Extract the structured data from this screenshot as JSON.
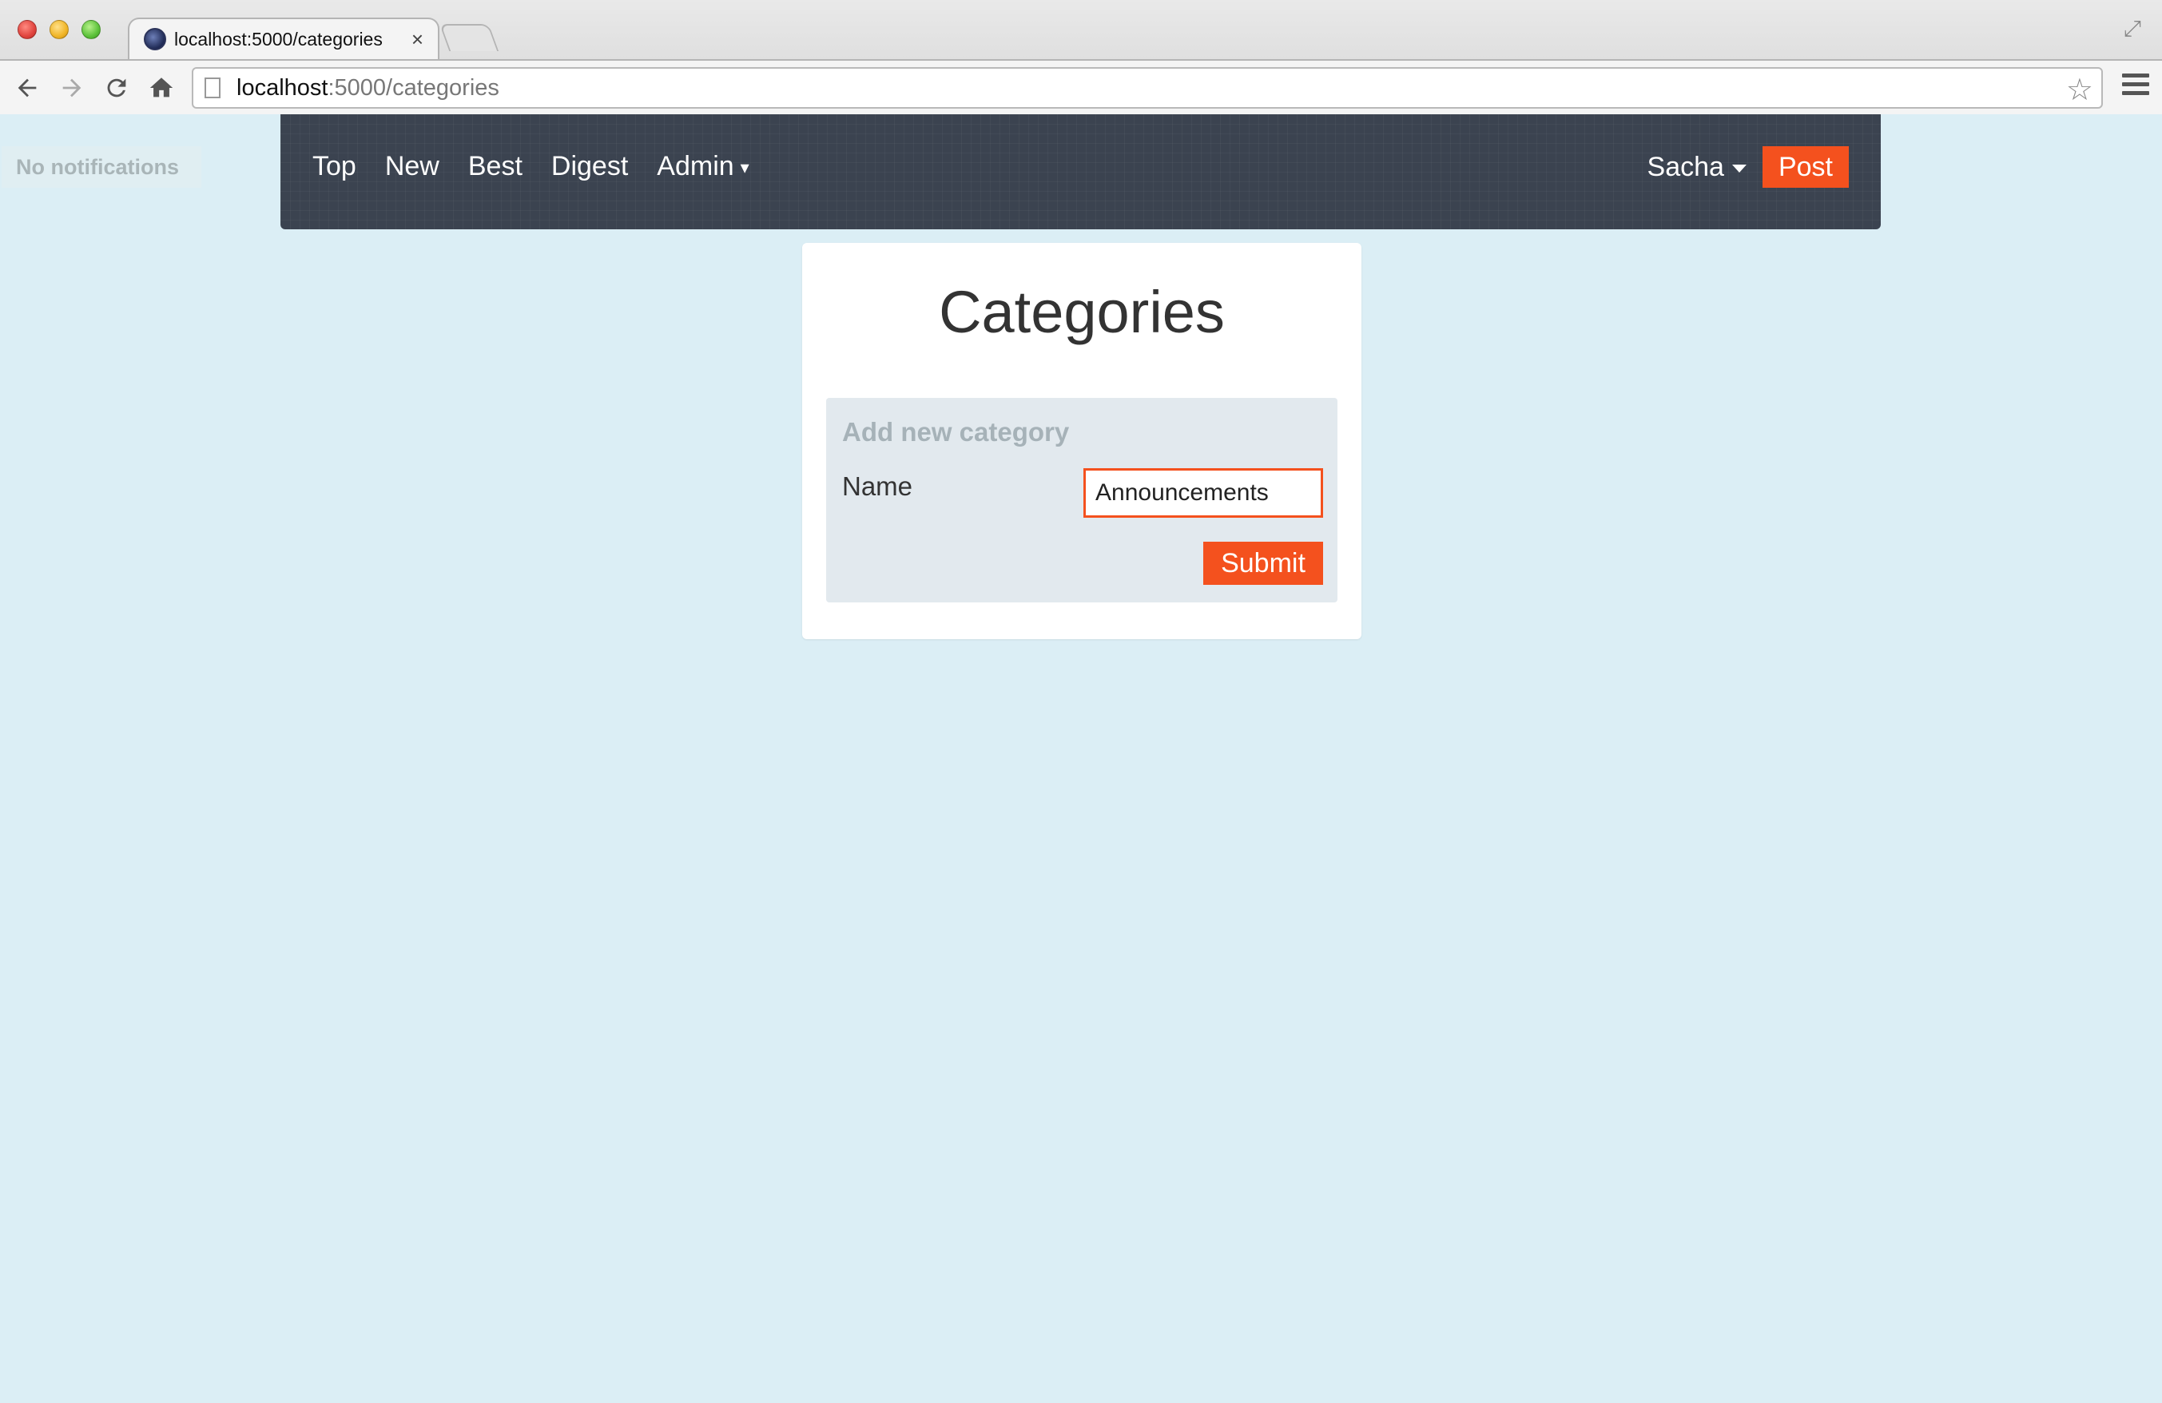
{
  "browser": {
    "tab_title": "localhost:5000/categories",
    "tab_close": "×",
    "url_host": "localhost",
    "url_rest": ":5000/categories"
  },
  "notifications": {
    "label": "No notifications"
  },
  "navbar": {
    "links": [
      {
        "label": "Top"
      },
      {
        "label": "New"
      },
      {
        "label": "Best"
      },
      {
        "label": "Digest"
      },
      {
        "label": "Admin",
        "caret": "▾"
      }
    ],
    "user": "Sacha",
    "post_label": "Post"
  },
  "page": {
    "title": "Categories",
    "form": {
      "legend": "Add new category",
      "name_label": "Name",
      "name_value": "Announcements",
      "submit_label": "Submit"
    }
  },
  "colors": {
    "accent": "#f4511e",
    "navbar": "#3b4350",
    "background": "#dbeef5"
  }
}
